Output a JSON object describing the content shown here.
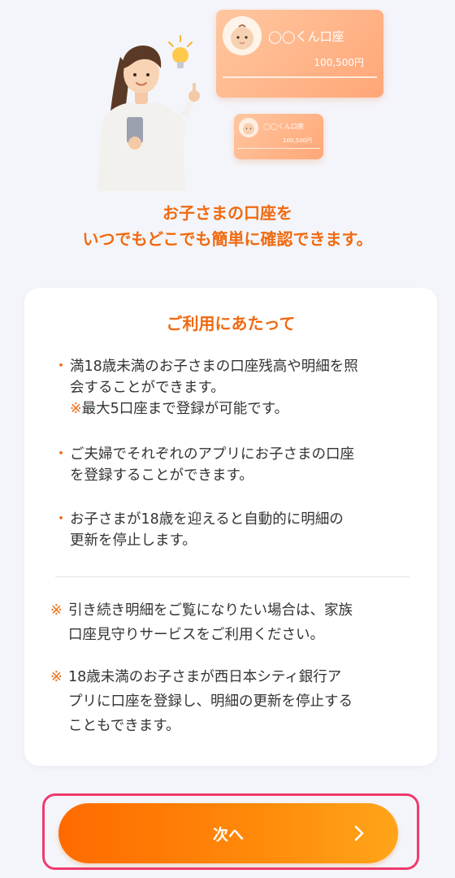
{
  "hero": {
    "card_big": {
      "account_name": "◯◯くん口座",
      "amount": "100,500円"
    },
    "card_small": {
      "account_name": "◯◯くん口座",
      "amount": "100,500円"
    }
  },
  "headline": {
    "line1": "お子さまの口座を",
    "line2": "いつでもどこでも簡単に確認できます。"
  },
  "panel": {
    "title": "ご利用にあたって",
    "bullets": [
      {
        "dot": "・",
        "lines": [
          "満18歳未満のお子さまの口座残高や明細を照",
          "会することができます。"
        ],
        "note": "※最大5口座まで登録が可能です。"
      },
      {
        "dot": "・",
        "lines": [
          "ご夫婦でそれぞれのアプリにお子さまの口座",
          "を登録することができます。"
        ]
      },
      {
        "dot": "・",
        "lines": [
          "お子さまが18歳を迎えると自動的に明細の",
          "更新を停止します。"
        ]
      }
    ],
    "notes": [
      {
        "mark": "※",
        "lines": [
          "引き続き明細をご覧になりたい場合は、家族",
          "口座見守りサービスをご利用ください。"
        ]
      },
      {
        "mark": "※",
        "lines": [
          "18歳未満のお子さまが西日本シティ銀行ア",
          "プリに口座を登録し、明細の更新を停止する",
          "こともできます。"
        ]
      }
    ]
  },
  "next_button": {
    "label": "次へ",
    "icon": "chevron-right-icon"
  },
  "colors": {
    "accent": "#f06a10",
    "button_gradient_start": "#ff6a00",
    "button_gradient_end": "#ffa51a",
    "highlight_frame": "#ef3a6e",
    "card": "#ffb389",
    "background": "#f4f5fa"
  }
}
